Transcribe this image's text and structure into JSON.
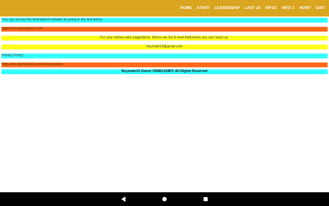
{
  "topbar": {
    "color": "#daa520",
    "nav": [
      "HOME",
      "START",
      "LEADERSHIP",
      "LAST 10",
      "INFO1",
      "INFO 2",
      "HOW?",
      "EXIT"
    ]
  },
  "content": {
    "access_text": "You can access the Boymate10 website by going to the link below.",
    "website_link": "https://en.boymate10.com/",
    "suggestions_text": "For your wishes and suggestions. Below are the E-mail Addresses you can reach us.",
    "email": "boymate10@gmail.com",
    "privacy_label": "Privacy Policy",
    "privacy_link": "https://en.boymate10.com/privacy-policy",
    "copyright": "Boymate10 Owner F9NB12X8PC All Rights Reserved"
  },
  "colors": {
    "cyan": "#33ffff",
    "orange": "#ff6a1a",
    "yellow": "#ffff1a"
  },
  "system_nav": {
    "back_icon": "back-triangle-icon",
    "home_icon": "home-circle-icon",
    "recents_icon": "recents-square-icon"
  }
}
